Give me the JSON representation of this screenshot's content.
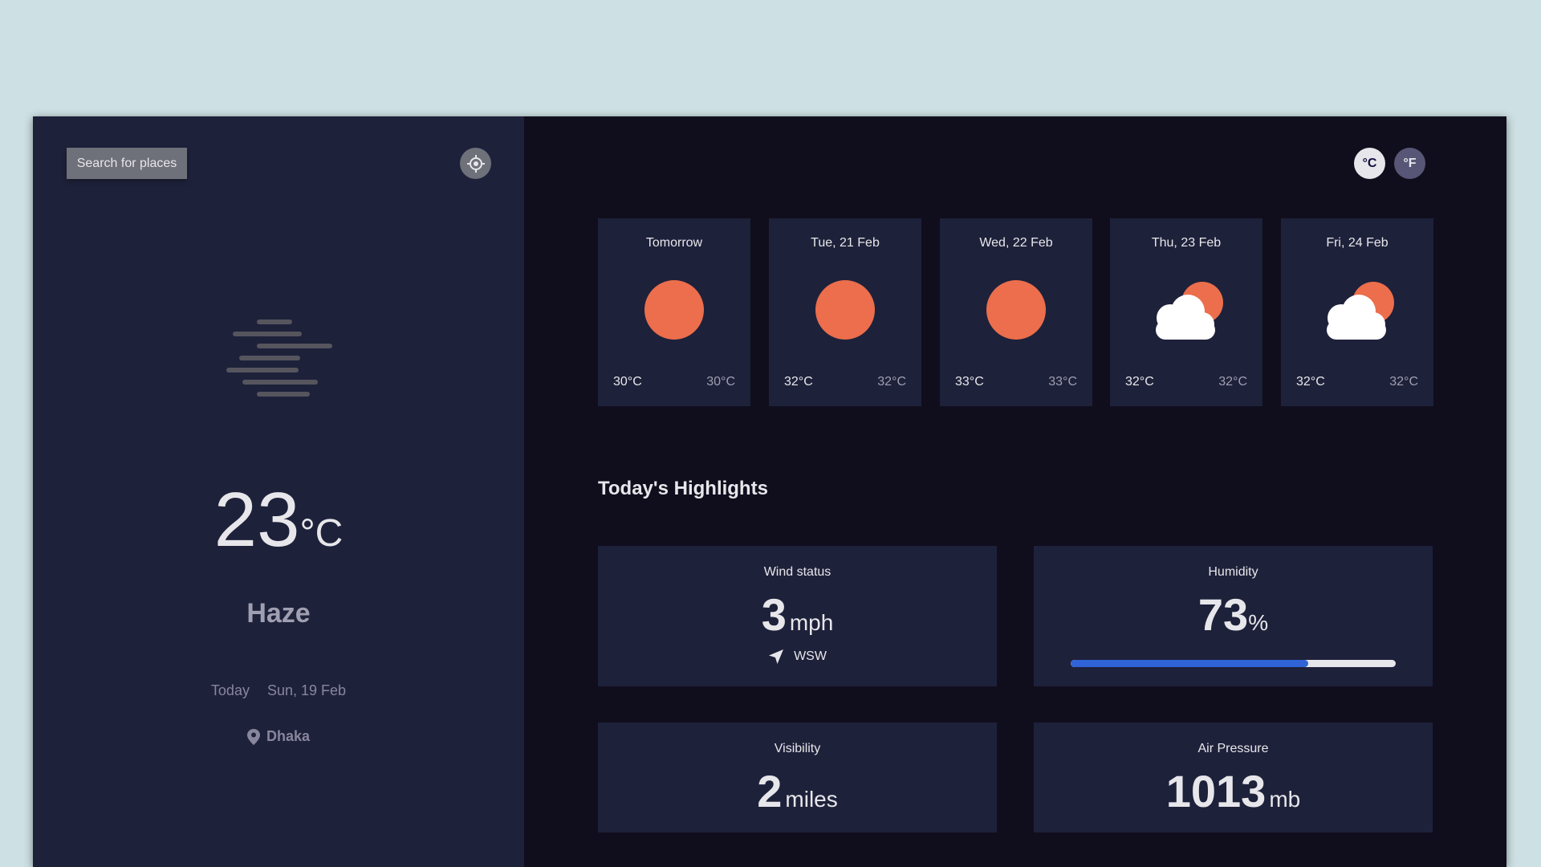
{
  "sidebar": {
    "search_label": "Search for places",
    "locate_icon": "crosshair-icon",
    "weather_icon": "haze-icon",
    "temperature": "23",
    "temperature_unit": "°C",
    "condition": "Haze",
    "date_prefix": "Today",
    "date_separator": "•",
    "date": "Sun, 19 Feb",
    "location_icon": "location-pin-icon",
    "location": "Dhaka"
  },
  "units": {
    "celsius_label": "°C",
    "fahrenheit_label": "°F",
    "selected": "celsius"
  },
  "forecast": [
    {
      "day": "Tomorrow",
      "icon": "sun-icon",
      "max": "30°C",
      "min": "30°C"
    },
    {
      "day": "Tue, 21 Feb",
      "icon": "sun-icon",
      "max": "32°C",
      "min": "32°C"
    },
    {
      "day": "Wed, 22 Feb",
      "icon": "sun-icon",
      "max": "33°C",
      "min": "33°C"
    },
    {
      "day": "Thu, 23 Feb",
      "icon": "partly-cloudy-icon",
      "max": "32°C",
      "min": "32°C"
    },
    {
      "day": "Fri, 24 Feb",
      "icon": "partly-cloudy-icon",
      "max": "32°C",
      "min": "32°C"
    }
  ],
  "highlights": {
    "title": "Today's Highlights",
    "wind": {
      "label": "Wind status",
      "value": "3",
      "unit": "mph",
      "direction": "WSW",
      "direction_icon": "navigation-arrow-icon"
    },
    "humidity": {
      "label": "Humidity",
      "value": "73",
      "unit": "%",
      "fraction": 0.73
    },
    "visibility": {
      "label": "Visibility",
      "value": "2",
      "unit": "miles"
    },
    "air_pressure": {
      "label": "Air Pressure",
      "value": "1013",
      "unit": "mb"
    }
  },
  "colors": {
    "sun": "#ec6e4c",
    "cloud": "#ffffff",
    "humidity_bar": "#2f63d6"
  }
}
